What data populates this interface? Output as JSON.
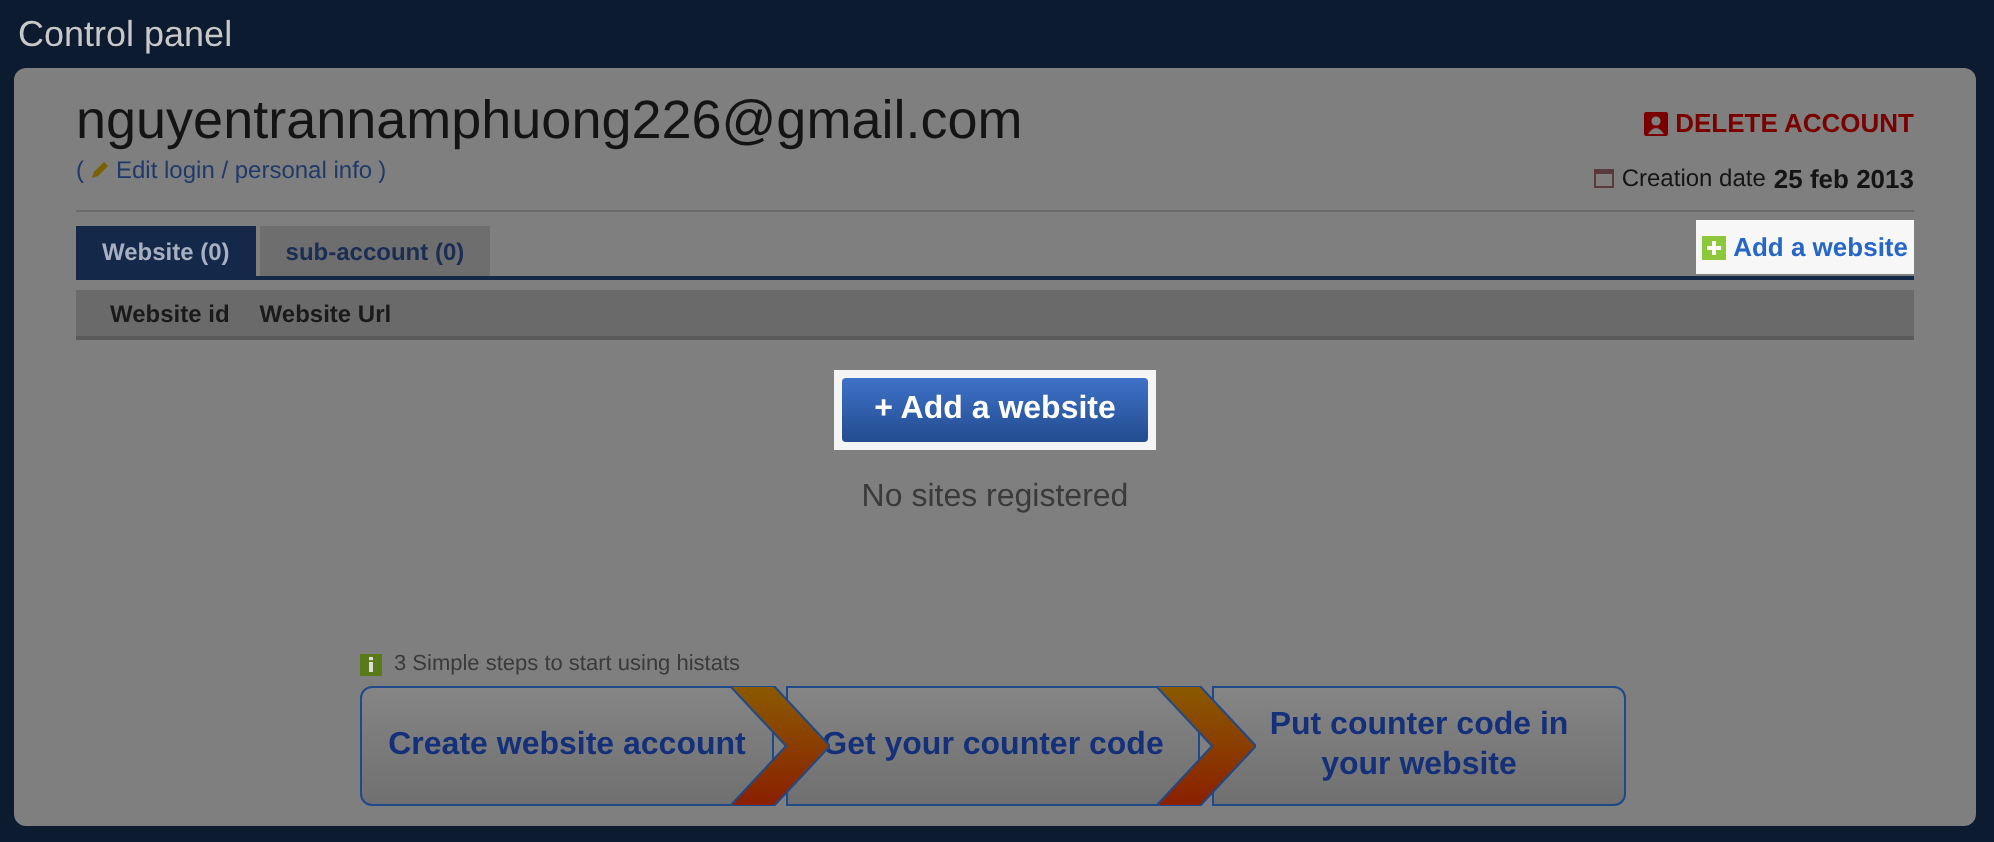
{
  "title": "Control panel",
  "account": {
    "email": "nguyentrannamphuong226@gmail.com",
    "open_paren": "(",
    "edit_link": "Edit login / personal info",
    "close_paren": ")",
    "delete_button": "DELETE ACCOUNT",
    "creation_label": "Creation date",
    "creation_date": "25 feb 2013"
  },
  "tabs": [
    {
      "label": "Website (0)",
      "selected": true
    },
    {
      "label": "sub-account (0)",
      "selected": false
    }
  ],
  "add_link": "Add a website",
  "table": {
    "columns": [
      "Website id",
      "Website Url"
    ]
  },
  "add_button": "+ Add a website",
  "empty_message": "No sites registered",
  "steps_hint": "3 Simple steps to start using histats",
  "steps": [
    "Create website account",
    "Get your counter code",
    "Put counter code in your website"
  ]
}
